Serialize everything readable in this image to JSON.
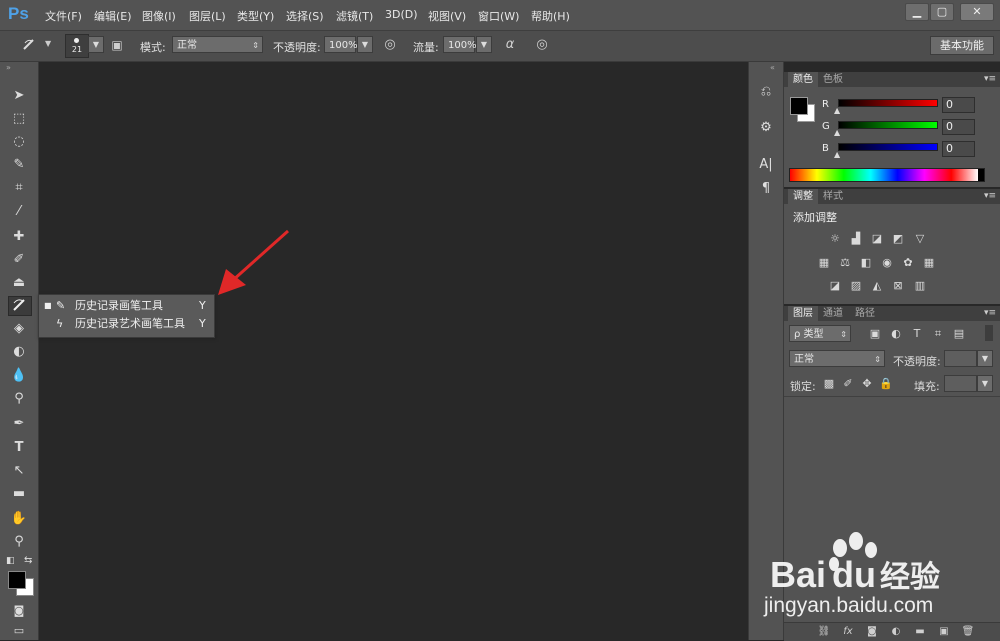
{
  "app": {
    "logo": "Ps"
  },
  "menubar": {
    "items": [
      "文件(F)",
      "编辑(E)",
      "图像(I)",
      "图层(L)",
      "类型(Y)",
      "选择(S)",
      "滤镜(T)",
      "3D(D)",
      "视图(V)",
      "窗口(W)",
      "帮助(H)"
    ],
    "window_buttons": [
      "▁",
      "▢",
      "✕"
    ]
  },
  "options": {
    "brush_size": "21",
    "mode_label": "模式:",
    "mode_value": "正常",
    "opacity_label": "不透明度:",
    "opacity_value": "100%",
    "flow_label": "流量:",
    "flow_value": "100%",
    "workspace": "基本功能"
  },
  "flyout": {
    "items": [
      {
        "label": "历史记录画笔工具",
        "shortcut": "Y",
        "selected": true
      },
      {
        "label": "历史记录艺术画笔工具",
        "shortcut": "Y",
        "selected": false
      }
    ]
  },
  "color_panel": {
    "tabs": [
      "颜色",
      "色板"
    ],
    "channels": [
      {
        "name": "R",
        "value": "0",
        "color": "#e02020"
      },
      {
        "name": "G",
        "value": "0",
        "color": "#20c020"
      },
      {
        "name": "B",
        "value": "0",
        "color": "#2030e0"
      }
    ]
  },
  "adjust_panel": {
    "tabs": [
      "调整",
      "样式"
    ],
    "title": "添加调整"
  },
  "layers_panel": {
    "tabs": [
      "图层",
      "通道",
      "路径"
    ],
    "kind": "ρ 类型",
    "blend": "正常",
    "opacity_label": "不透明度:",
    "lock_label": "锁定:",
    "fill_label": "填充:"
  },
  "watermark": {
    "brand": "Bai",
    "brand2": "du",
    "jingyan": "经验",
    "url": "jingyan.baidu.com"
  },
  "colors": {
    "accent": "#4fa2e8",
    "arrow": "#e02828"
  }
}
